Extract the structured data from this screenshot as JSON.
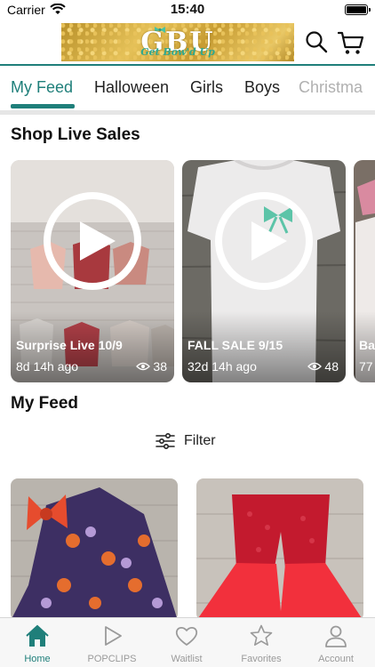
{
  "status_bar": {
    "carrier": "Carrier",
    "time": "15:40"
  },
  "header": {
    "logo_text": "GBU",
    "logo_tagline": "Get Bow'd Up"
  },
  "tabs": [
    {
      "label": "My Feed"
    },
    {
      "label": "Halloween"
    },
    {
      "label": "Girls"
    },
    {
      "label": "Boys"
    },
    {
      "label": "Christma"
    }
  ],
  "live_sales": {
    "title": "Shop Live Sales",
    "cards": [
      {
        "title": "Surprise Live 10/9",
        "age": "8d 14h ago",
        "views": "38"
      },
      {
        "title": "FALL SALE 9/15",
        "age": "32d 14h ago",
        "views": "48"
      },
      {
        "title": "Ba",
        "age": "77",
        "views": ""
      }
    ]
  },
  "feed": {
    "title": "My Feed",
    "filter_label": "Filter"
  },
  "bottom_nav": [
    {
      "label": "Home",
      "icon": "home-icon"
    },
    {
      "label": "POPCLIPS",
      "icon": "play-icon"
    },
    {
      "label": "Waitlist",
      "icon": "heart-icon"
    },
    {
      "label": "Favorites",
      "icon": "star-icon"
    },
    {
      "label": "Account",
      "icon": "person-icon"
    }
  ],
  "colors": {
    "accent": "#1f7f7a",
    "inactive": "#9a9a9a"
  }
}
